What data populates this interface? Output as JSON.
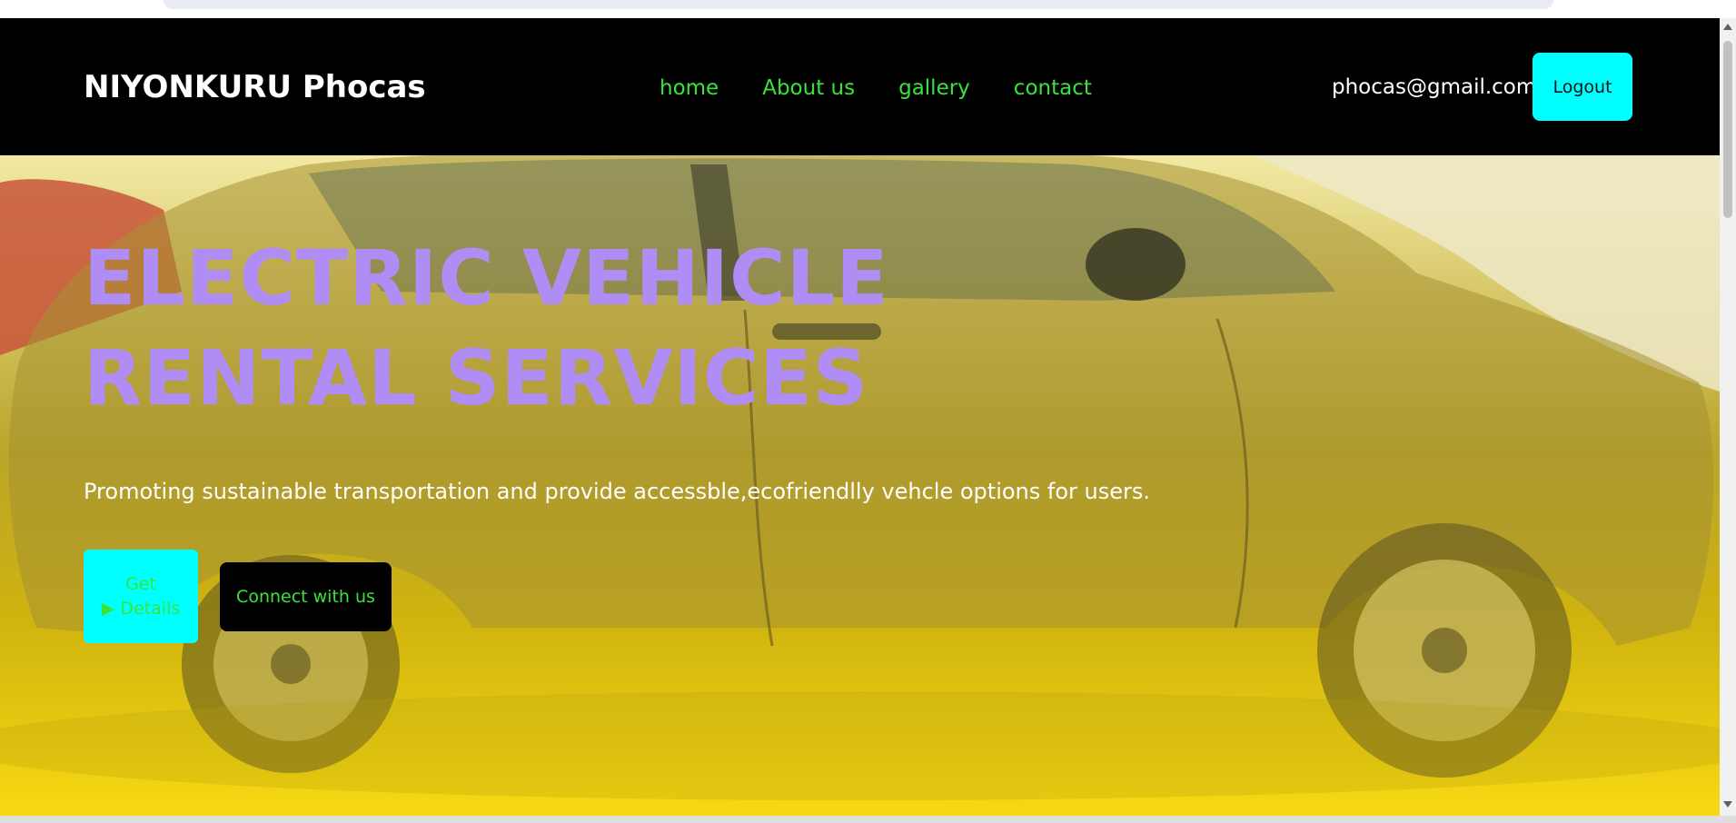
{
  "navbar": {
    "brand": "NIYONKURU Phocas",
    "links": [
      "home",
      "About us",
      "gallery",
      "contact"
    ],
    "user_email": "phocas@gmail.com",
    "logout_label": "Logout"
  },
  "hero": {
    "title": "ELECTRIC VEHICLE RENTAL SERVICES",
    "subtitle": "Promoting sustainable transportation and provide accessble,ecofriendlly vehcle options for users.",
    "details_button": {
      "line1": "Get",
      "line2": "Details",
      "icon": "play-triangle-icon"
    },
    "connect_label": "Connect with us",
    "background_image": "car-photo"
  },
  "colors": {
    "navbar_bg": "#000000",
    "nav_link": "#39e33b",
    "accent_cyan": "#00ffff",
    "hero_title": "#b08cf5",
    "hero_yellow": "#f7d912"
  }
}
